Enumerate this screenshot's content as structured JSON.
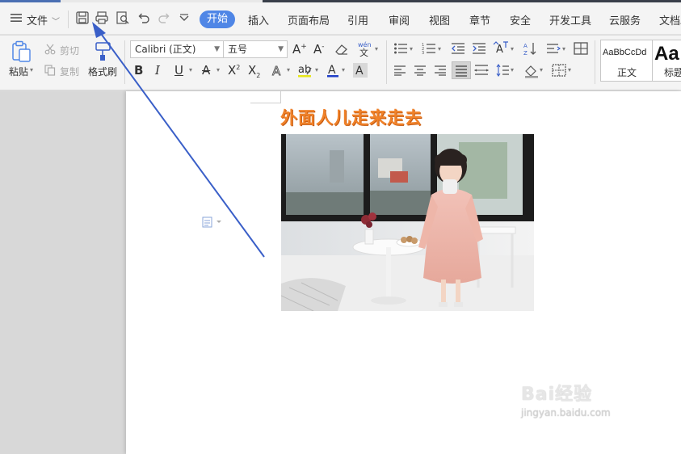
{
  "menubar": {
    "file_label": "文件",
    "tabs": [
      {
        "label": "开始",
        "active": true
      },
      {
        "label": "插入"
      },
      {
        "label": "页面布局"
      },
      {
        "label": "引用"
      },
      {
        "label": "审阅"
      },
      {
        "label": "视图"
      },
      {
        "label": "章节"
      },
      {
        "label": "安全"
      },
      {
        "label": "开发工具"
      },
      {
        "label": "云服务"
      },
      {
        "label": "文档助"
      }
    ],
    "quick_access": [
      "save-icon",
      "print-icon",
      "print-preview-icon",
      "undo-icon",
      "redo-icon",
      "more-icon"
    ]
  },
  "ribbon": {
    "paste_label": "粘贴",
    "cut_label": "剪切",
    "copy_label": "复制",
    "format_painter_label": "格式刷",
    "font_name": "Calibri (正文)",
    "font_size": "五号",
    "style_normal_preview": "AaBbCcDd",
    "style_normal_label": "正文",
    "style_heading_preview": "Aa",
    "style_heading_label": "标题",
    "accent_color": "#4f86e6",
    "font_color": "#d43030",
    "highlight_color": "#2140c8"
  },
  "document": {
    "title": "外面人儿走来走去",
    "title_color": "#f0822a"
  },
  "watermark": {
    "logo_text": "Bai经验",
    "url": "jingyan.baidu.com"
  },
  "annotation": {
    "arrow_color": "#3a5fc8"
  }
}
